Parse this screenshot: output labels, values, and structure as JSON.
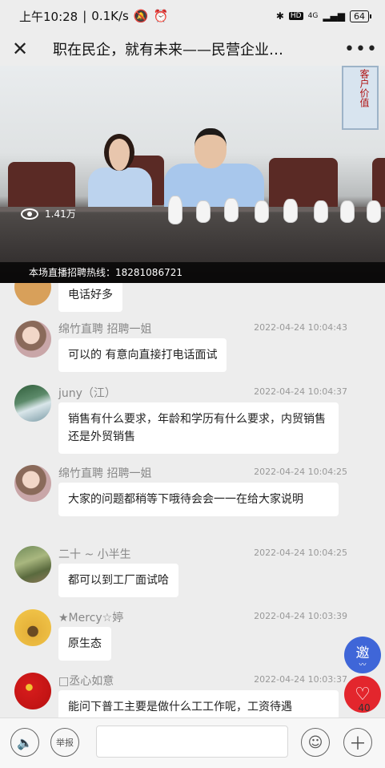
{
  "status_bar": {
    "time": "上午10:28",
    "speed": "0.1K/s",
    "network": "4G",
    "battery": "64"
  },
  "header": {
    "title": "职在民企，就有未来——民营企业…"
  },
  "video": {
    "wall_text": "客户价值",
    "viewers": "1.41万",
    "hotline": "本场直播招聘热线：18281086721"
  },
  "messages": [
    {
      "name": "",
      "time": "",
      "text": "电话好多"
    },
    {
      "name": "绵竹直聘 招聘一姐",
      "time": "2022-04-24 10:04:43",
      "text": "可以的 有意向直接打电话面试"
    },
    {
      "name": "juny（江）",
      "time": "2022-04-24 10:04:37",
      "text": "销售有什么要求，年龄和学历有什么要求，内贸销售还是外贸销售"
    },
    {
      "name": "绵竹直聘 招聘一姐",
      "time": "2022-04-24 10:04:25",
      "text": "大家的问题都稍等下哦待会会一一在给大家说明"
    },
    {
      "name": "二十 ~ 小半生",
      "time": "2022-04-24 10:04:25",
      "text": "都可以到工厂面试哈"
    },
    {
      "name": "★Mercy☆婷",
      "time": "2022-04-24 10:03:39",
      "text": "原生态"
    },
    {
      "name": "□丞心如意",
      "time": "2022-04-24 10:03:37",
      "text": "能问下普工主要是做什么工工作呢，工资待遇"
    }
  ],
  "floating": {
    "invite_label": "邀",
    "like_count": "40"
  },
  "bottom_bar": {
    "report_label": "举报",
    "input_placeholder": ""
  }
}
